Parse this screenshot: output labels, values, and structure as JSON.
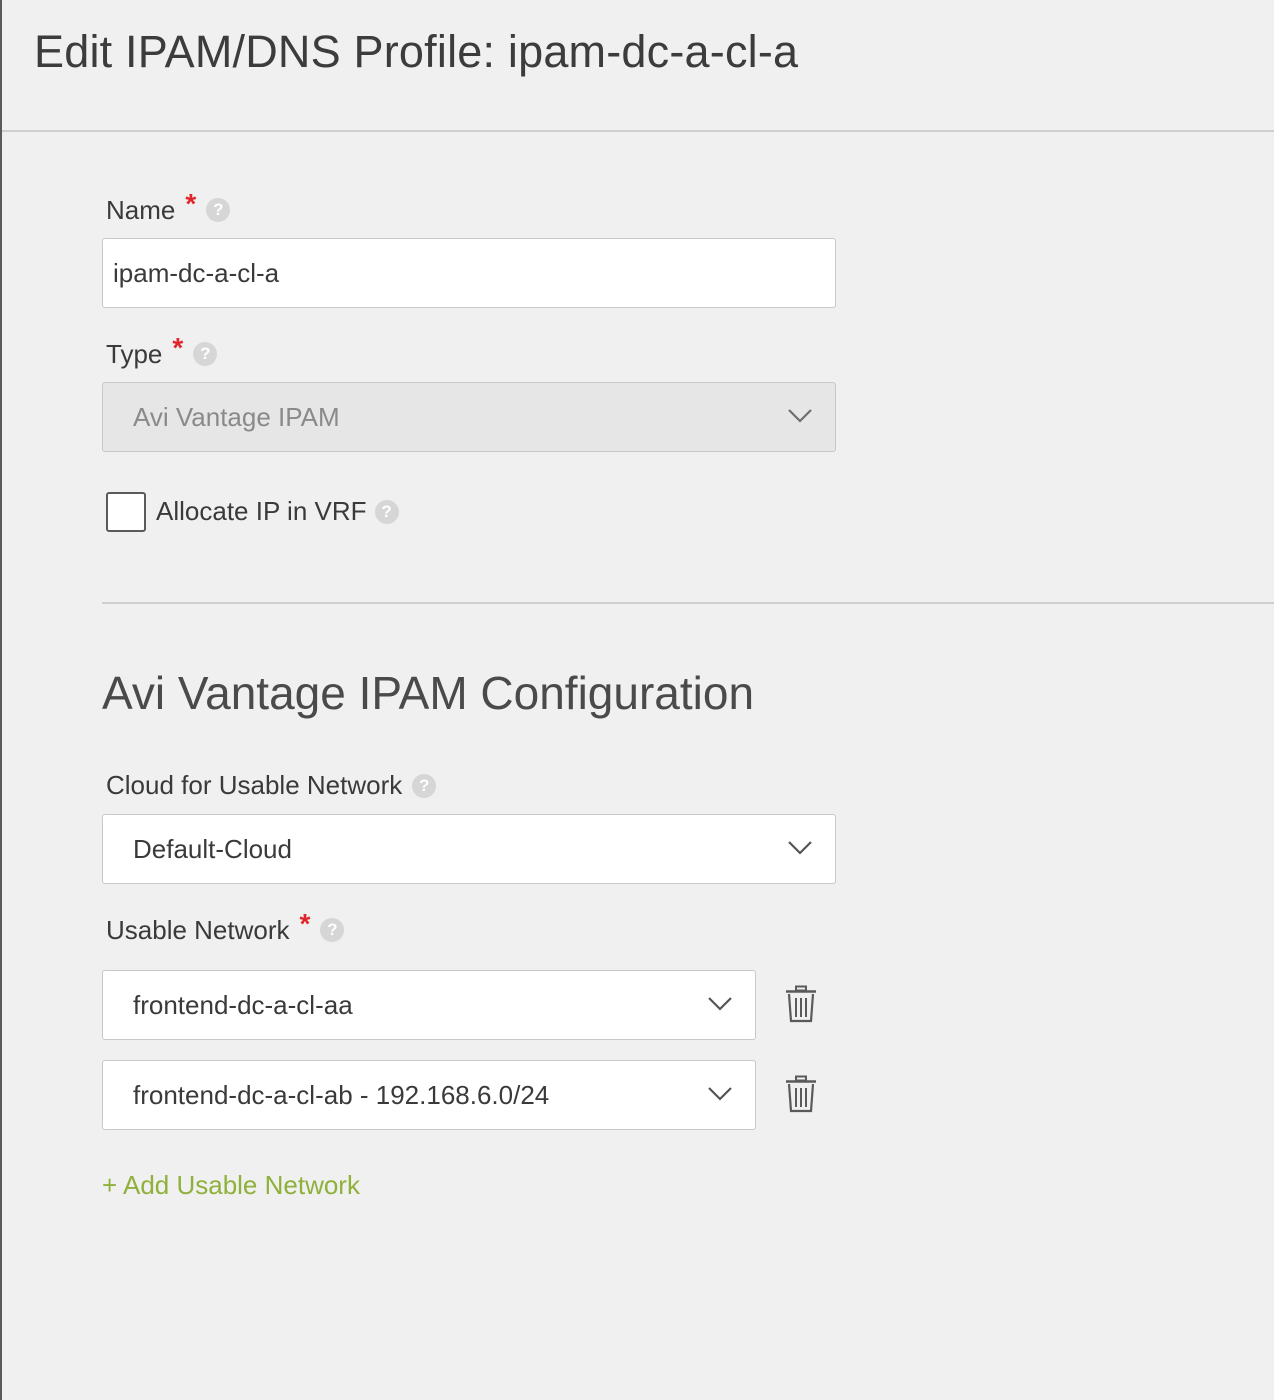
{
  "header": {
    "title": "Edit IPAM/DNS Profile: ipam-dc-a-cl-a"
  },
  "form": {
    "name": {
      "label": "Name",
      "required_mark": "*",
      "value": "ipam-dc-a-cl-a"
    },
    "type": {
      "label": "Type",
      "required_mark": "*",
      "value": "Avi Vantage IPAM",
      "disabled": true
    },
    "allocate_ip_in_vrf": {
      "label": "Allocate IP in VRF",
      "checked": false
    }
  },
  "ipam_config": {
    "title": "Avi Vantage IPAM Configuration",
    "cloud": {
      "label": "Cloud for Usable Network",
      "value": "Default-Cloud"
    },
    "usable_network": {
      "label": "Usable Network",
      "required_mark": "*",
      "items": [
        {
          "value": "frontend-dc-a-cl-aa"
        },
        {
          "value": "frontend-dc-a-cl-ab - 192.168.6.0/24"
        }
      ],
      "add_label": "+ Add Usable Network"
    }
  },
  "icons": {
    "help": "help-circle-icon",
    "dropdown": "chevron-down-icon",
    "remove": "trash-icon"
  },
  "help_glyph": "?",
  "colors": {
    "background": "#f0f0f0",
    "required": "#e0262b",
    "link": "#8fb13b",
    "border": "#c8c8c8"
  }
}
